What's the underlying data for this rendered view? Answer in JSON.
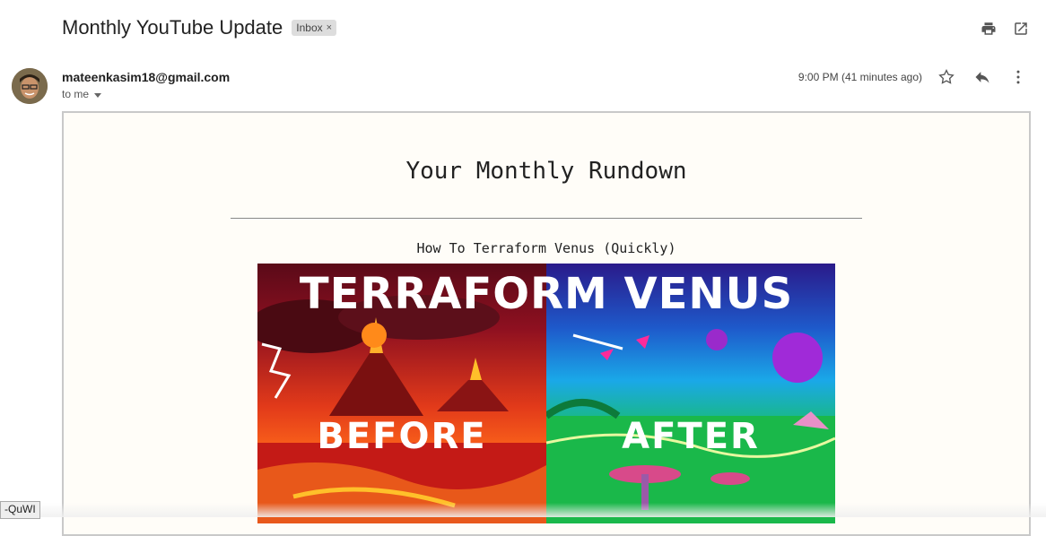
{
  "email": {
    "subject": "Monthly YouTube Update",
    "label": "Inbox",
    "label_remove": "×",
    "sender": "mateenkasim18@gmail.com",
    "recipient": "to me",
    "time": "9:00 PM (41 minutes ago)"
  },
  "icons": {
    "print": "print-icon",
    "open_new_window": "open-in-new-window-icon",
    "star": "star-icon",
    "reply": "reply-icon",
    "more": "more-vertical-icon",
    "dropdown": "chevron-down-icon"
  },
  "body": {
    "heading": "Your Monthly Rundown",
    "video_title": "How To Terraform Venus (Quickly)",
    "thumbnail": {
      "title": "TERRAFORM VENUS",
      "left_label": "BEFORE",
      "right_label": "AFTER"
    }
  },
  "tooltip": "-QuWI"
}
